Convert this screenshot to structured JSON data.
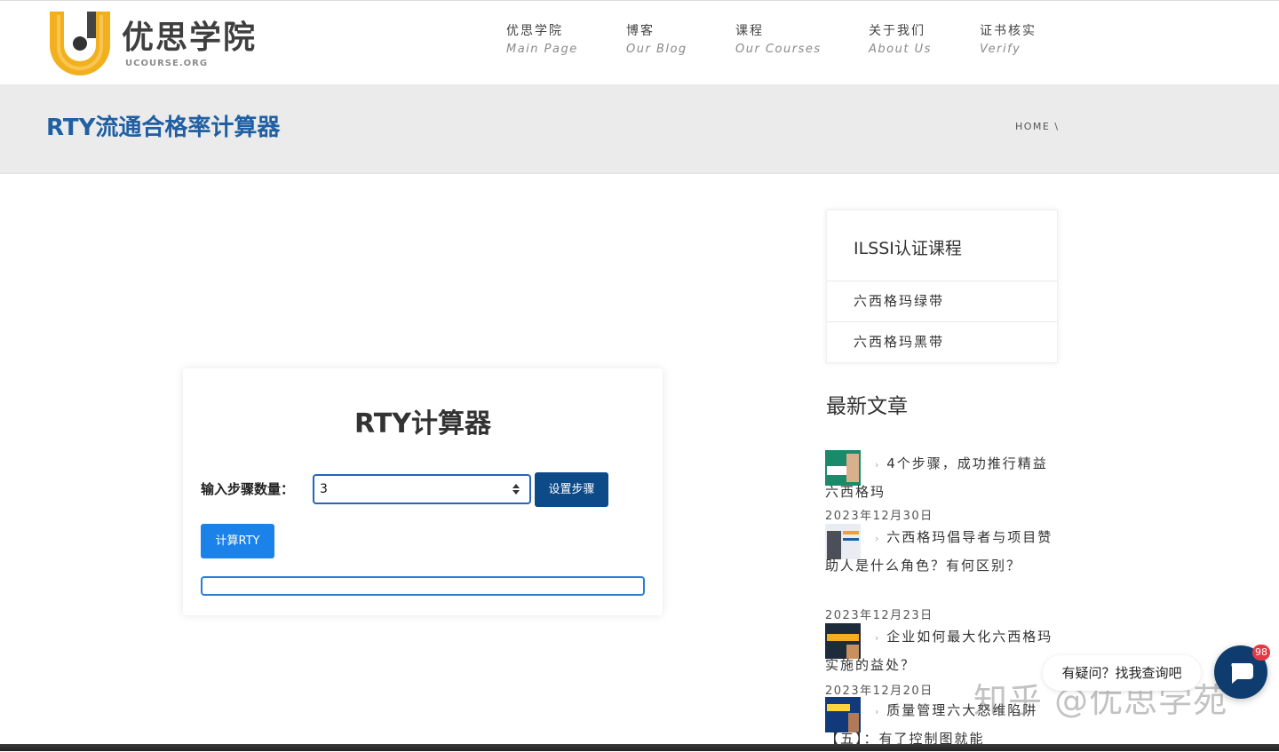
{
  "header": {
    "brand_name": "优思学院",
    "brand_sub": "UCOURSE.ORG",
    "nav": [
      {
        "cn": "优思学院",
        "en": "Main Page"
      },
      {
        "cn": "博客",
        "en": "Our Blog"
      },
      {
        "cn": "课程",
        "en": "Our Courses"
      },
      {
        "cn": "关于我们",
        "en": "About Us"
      },
      {
        "cn": "证书核实",
        "en": "Verify"
      }
    ]
  },
  "title_band": {
    "page_title": "RTY流通合格率计算器",
    "breadcrumb": "HOME \\"
  },
  "calculator": {
    "title": "RTY计算器",
    "steps_label": "输入步骤数量：",
    "steps_value": "3",
    "set_steps_label": "设置步骤",
    "calculate_label": "计算RTY",
    "result": ""
  },
  "sidebar": {
    "courses_title": "ILSSI认证课程",
    "courses": [
      "六西格玛绿带",
      "六西格玛黑带"
    ],
    "recent_title": "最新文章",
    "posts": [
      {
        "title": "4个步骤，成功推行精益六西格玛",
        "date": "2023年12月30日"
      },
      {
        "title": "六西格玛倡导者与项目赞助人是什么角色？有何区别？",
        "date": "2023年12月23日"
      },
      {
        "title": "企业如何最大化六西格玛实施的益处？",
        "date": "2023年12月20日"
      },
      {
        "title": "质量管理六大怒维陷阱【五】：有了控制图就能",
        "date": ""
      }
    ]
  },
  "chat": {
    "prompt": "有疑问？找我查询吧",
    "badge": "98"
  },
  "watermark": "知乎 @优思学苑",
  "colors": {
    "brand_yellow": "#f2b01e",
    "title_blue": "#1f5fa3",
    "set_button": "#0d4a88",
    "calc_button": "#1a82e8"
  }
}
